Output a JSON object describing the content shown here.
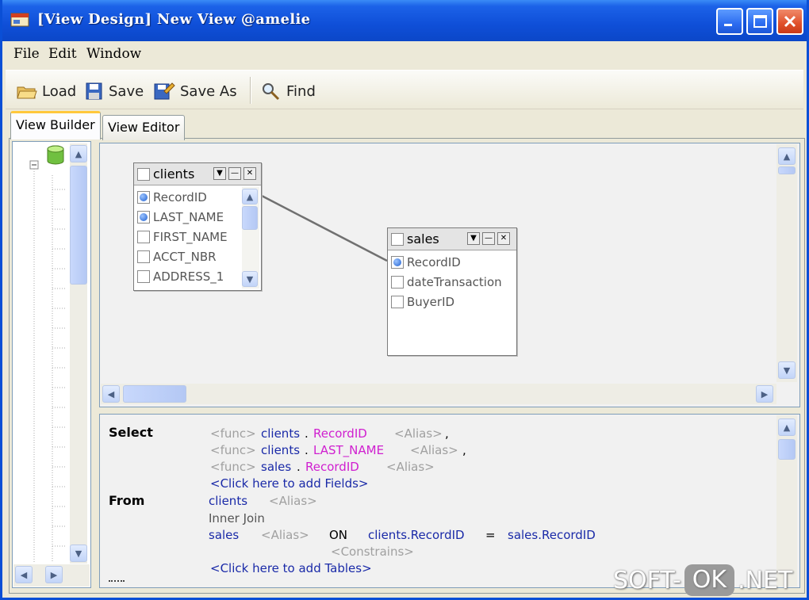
{
  "window": {
    "title": "[View Design] New View @amelie"
  },
  "menu": [
    "File",
    "Edit",
    "Window"
  ],
  "toolbar": {
    "load": "Load",
    "save": "Save",
    "save_as": "Save As",
    "find": "Find"
  },
  "tabs": {
    "view_builder": "View Builder",
    "view_editor": "View Editor"
  },
  "tables": {
    "clients": {
      "name": "clients",
      "fields": [
        {
          "label": "RecordID",
          "checked": true
        },
        {
          "label": "LAST_NAME",
          "checked": true
        },
        {
          "label": "FIRST_NAME",
          "checked": false
        },
        {
          "label": "ACCT_NBR",
          "checked": false
        },
        {
          "label": "ADDRESS_1",
          "checked": false
        }
      ]
    },
    "sales": {
      "name": "sales",
      "fields": [
        {
          "label": "RecordID",
          "checked": true
        },
        {
          "label": "dateTransaction",
          "checked": false
        },
        {
          "label": "BuyerID",
          "checked": false
        }
      ]
    }
  },
  "sql": {
    "select_kw": "Select",
    "from_kw": "From",
    "func": "<func>",
    "alias": "<Alias>",
    "comma": ",",
    "dot": ".",
    "clients": "clients",
    "sales": "sales",
    "recordid": "RecordID",
    "last_name": "LAST_NAME",
    "add_fields": "<Click here to add Fields>",
    "inner_join": "Inner Join",
    "on": "ON",
    "left_col": "clients.RecordID",
    "eq": "=",
    "right_col": "sales.RecordID",
    "constrains": "<Constrains>",
    "add_tables": "<Click here to add Tables>"
  },
  "watermark": {
    "left": "SOFT-",
    "ok": "OK",
    "right": ".NET"
  }
}
